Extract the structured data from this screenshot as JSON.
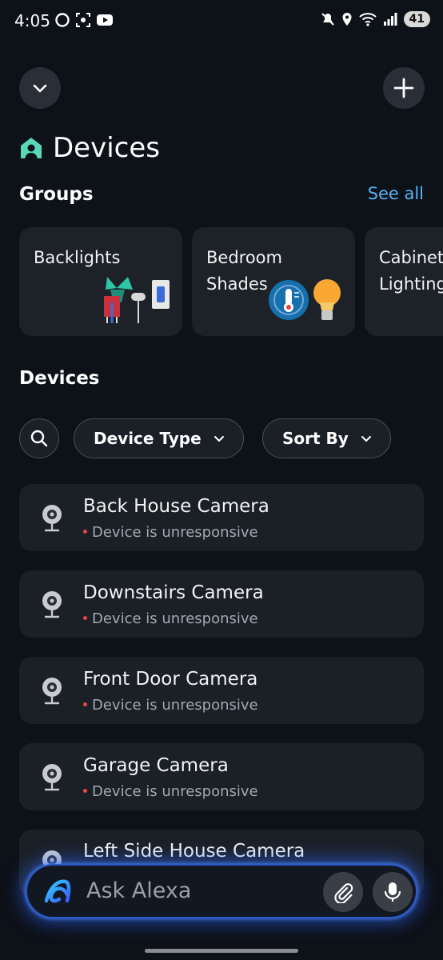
{
  "status_bar": {
    "time": "4:05",
    "battery": "41"
  },
  "header": {
    "collapse_icon": "chevron-down-icon",
    "add_icon": "plus-icon"
  },
  "page": {
    "title": "Devices",
    "title_icon": "home-person-icon"
  },
  "groups": {
    "title": "Groups",
    "see_all": "See all",
    "items": [
      {
        "line1": "Backlights",
        "line2": ""
      },
      {
        "line1": "Bedroom",
        "line2": "Shades"
      },
      {
        "line1": "Cabinet",
        "line2": "Lighting"
      }
    ]
  },
  "devices": {
    "title": "Devices",
    "filters": {
      "device_type": "Device Type",
      "sort_by": "Sort By"
    },
    "items": [
      {
        "name": "Back House Camera",
        "status": "Device is unresponsive"
      },
      {
        "name": "Downstairs Camera",
        "status": "Device is unresponsive"
      },
      {
        "name": "Front Door Camera",
        "status": "Device is unresponsive"
      },
      {
        "name": "Garage Camera",
        "status": "Device is unresponsive"
      },
      {
        "name": "Left Side House Camera",
        "status": ""
      }
    ]
  },
  "alexa": {
    "placeholder": "Ask Alexa"
  },
  "colors": {
    "accent": "#55b3f3",
    "status_dot": "#ee4444",
    "alexa_glow": "#2e66ff"
  }
}
